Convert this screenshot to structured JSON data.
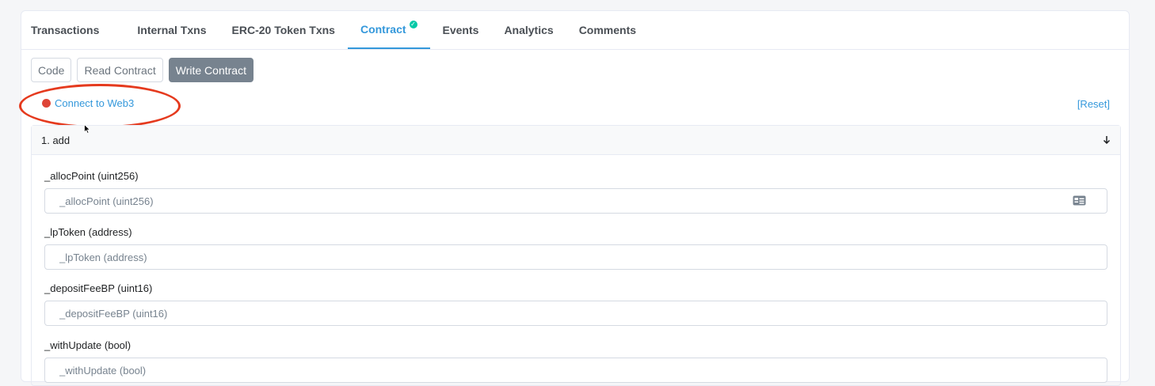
{
  "tabs": [
    {
      "label": "Transactions"
    },
    {
      "label": "Internal Txns"
    },
    {
      "label": "ERC-20 Token Txns"
    },
    {
      "label": "Contract"
    },
    {
      "label": "Events"
    },
    {
      "label": "Analytics"
    },
    {
      "label": "Comments"
    }
  ],
  "active_tab": "Contract",
  "subtabs": {
    "code": "Code",
    "read": "Read Contract",
    "write": "Write Contract"
  },
  "connect": {
    "label": "Connect to Web3"
  },
  "reset": {
    "label": "[Reset]"
  },
  "function": {
    "title": "1. add",
    "params": [
      {
        "label": "_allocPoint (uint256)",
        "placeholder": "_allocPoint (uint256)"
      },
      {
        "label": "_lpToken (address)",
        "placeholder": "_lpToken (address)"
      },
      {
        "label": "_depositFeeBP (uint16)",
        "placeholder": "_depositFeeBP (uint16)"
      },
      {
        "label": "_withUpdate (bool)",
        "placeholder": "_withUpdate (bool)"
      }
    ]
  },
  "colors": {
    "accent": "#3498db",
    "status_dot": "#de4437",
    "annotation": "#e53a1e",
    "verified": "#00c9a7"
  }
}
